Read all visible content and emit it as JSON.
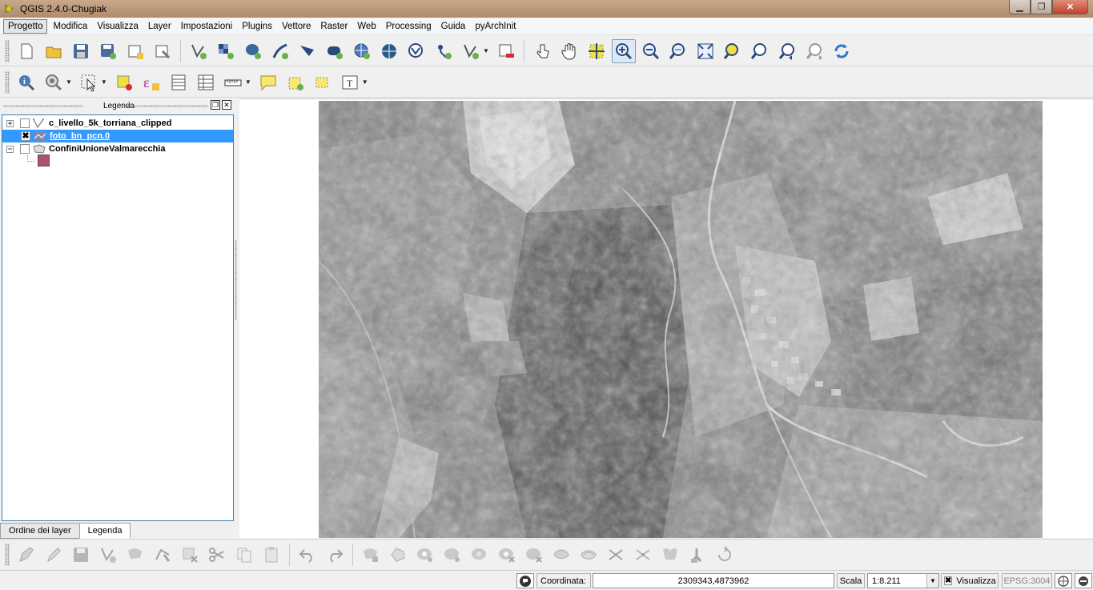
{
  "window": {
    "title": "QGIS 2.4.0-Chugiak",
    "controls": {
      "minimize": "▁",
      "maximize": "❐",
      "close": "✕"
    }
  },
  "menu": [
    "Progetto",
    "Modifica",
    "Visualizza",
    "Layer",
    "Impostazioni",
    "Plugins",
    "Vettore",
    "Raster",
    "Web",
    "Processing",
    "Guida",
    "pyArchInit"
  ],
  "toolbar_file": [
    "new-project-icon",
    "open-project-icon",
    "save-project-icon",
    "save-as-icon",
    "new-print-composer-icon",
    "composer-manager-icon"
  ],
  "toolbar_layers": [
    "add-vector-layer-icon",
    "add-raster-layer-icon",
    "add-postgis-layer-icon",
    "add-spatialite-layer-icon",
    "add-mssql-layer-icon",
    "add-oracle-layer-icon",
    "add-wms-layer-icon",
    "add-wcs-layer-icon",
    "add-wfs-layer-icon",
    "add-delimited-text-icon",
    "new-shapefile-icon",
    "remove-layer-icon"
  ],
  "toolbar_nav": [
    "touch-zoom-icon",
    "pan-icon",
    "pan-to-selection-icon",
    "zoom-in-icon",
    "zoom-out-icon",
    "zoom-native-icon",
    "zoom-full-icon",
    "zoom-to-selection-icon",
    "zoom-to-layer-icon",
    "zoom-last-icon",
    "zoom-next-icon",
    "refresh-icon"
  ],
  "toolbar_attr": [
    "identify-icon",
    "action-icon",
    "select-icon",
    "deselect-icon",
    "field-calculator-icon",
    "attribute-table-icon",
    "statistics-icon",
    "measure-icon",
    "map-tips-icon",
    "new-bookmark-icon",
    "show-bookmarks-icon",
    "text-annotation-icon"
  ],
  "toolbar_edit": [
    "current-edits-icon",
    "toggle-editing-icon",
    "save-edits-icon",
    "add-feature-icon",
    "move-feature-icon",
    "node-tool-icon",
    "delete-selected-icon",
    "cut-features-icon",
    "copy-features-icon",
    "paste-features-icon",
    "undo-icon",
    "redo-icon",
    "rotate-point-icon",
    "simplify-icon",
    "add-ring-icon",
    "add-part-icon",
    "fill-ring-icon",
    "delete-ring-icon",
    "delete-part-icon",
    "reshape-icon",
    "offset-curve-icon",
    "split-features-icon",
    "split-parts-icon",
    "merge-features-icon",
    "merge-attributes-icon",
    "rotate-symbols-icon"
  ],
  "legend": {
    "title": "Legenda",
    "layers": [
      {
        "name": "c_livello_5k_torriana_clipped",
        "checked": false,
        "type": "vector-line"
      },
      {
        "name": "foto_bn_pcn.0",
        "checked": true,
        "type": "raster"
      },
      {
        "name": "ConfiniUnioneValmarecchia",
        "checked": false,
        "type": "vector-polygon"
      }
    ],
    "symbol_color": "#b05070",
    "tabs": [
      "Ordine dei layer",
      "Legenda"
    ]
  },
  "status": {
    "coord_label": "Coordinata:",
    "coord_value": "2309343,4873962",
    "scale_label": "Scala",
    "scale_value": "1:8.211",
    "render_label": "Visualizza",
    "crs": "EPSG:3004"
  }
}
